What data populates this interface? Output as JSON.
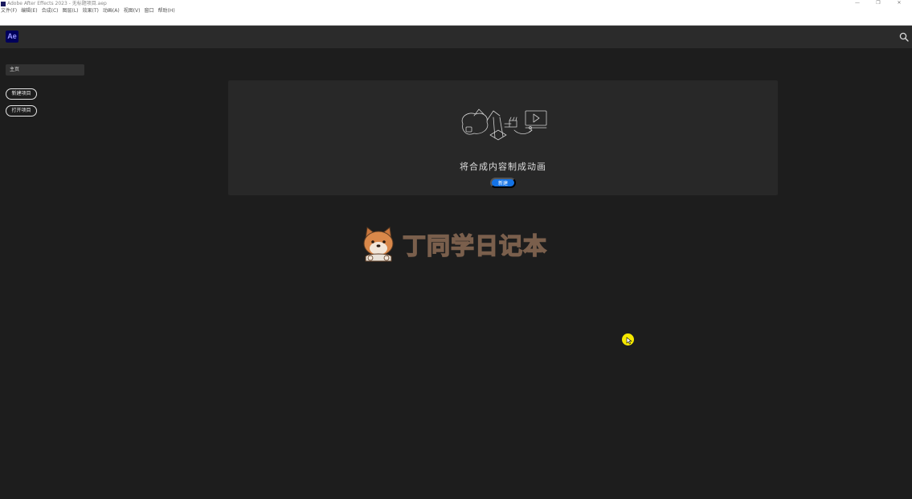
{
  "window": {
    "title": "Adobe After Effects 2023 - 无标题项目.aep",
    "controls": [
      "—",
      "❐",
      "✕"
    ]
  },
  "menu": [
    "文件(F)",
    "编辑(E)",
    "合成(C)",
    "图层(L)",
    "效果(T)",
    "动画(A)",
    "视图(V)",
    "窗口",
    "帮助(H)"
  ],
  "header": {
    "logo": "Ae"
  },
  "sidebar": {
    "home_tab": "主页",
    "new_project": "新建项目",
    "open_project": "打开项目"
  },
  "hero": {
    "message": "将合成内容制成动画",
    "button": "新建"
  },
  "watermark": {
    "text": "丁同学日记本"
  },
  "colors": {
    "background": "#1d1d1d",
    "header": "#2b2b2b",
    "card": "#282828",
    "accent": "#1473e6",
    "ae_logo_bg": "#00005b",
    "ae_logo_fg": "#9999ff",
    "cursor_highlight": "#f5e800"
  }
}
